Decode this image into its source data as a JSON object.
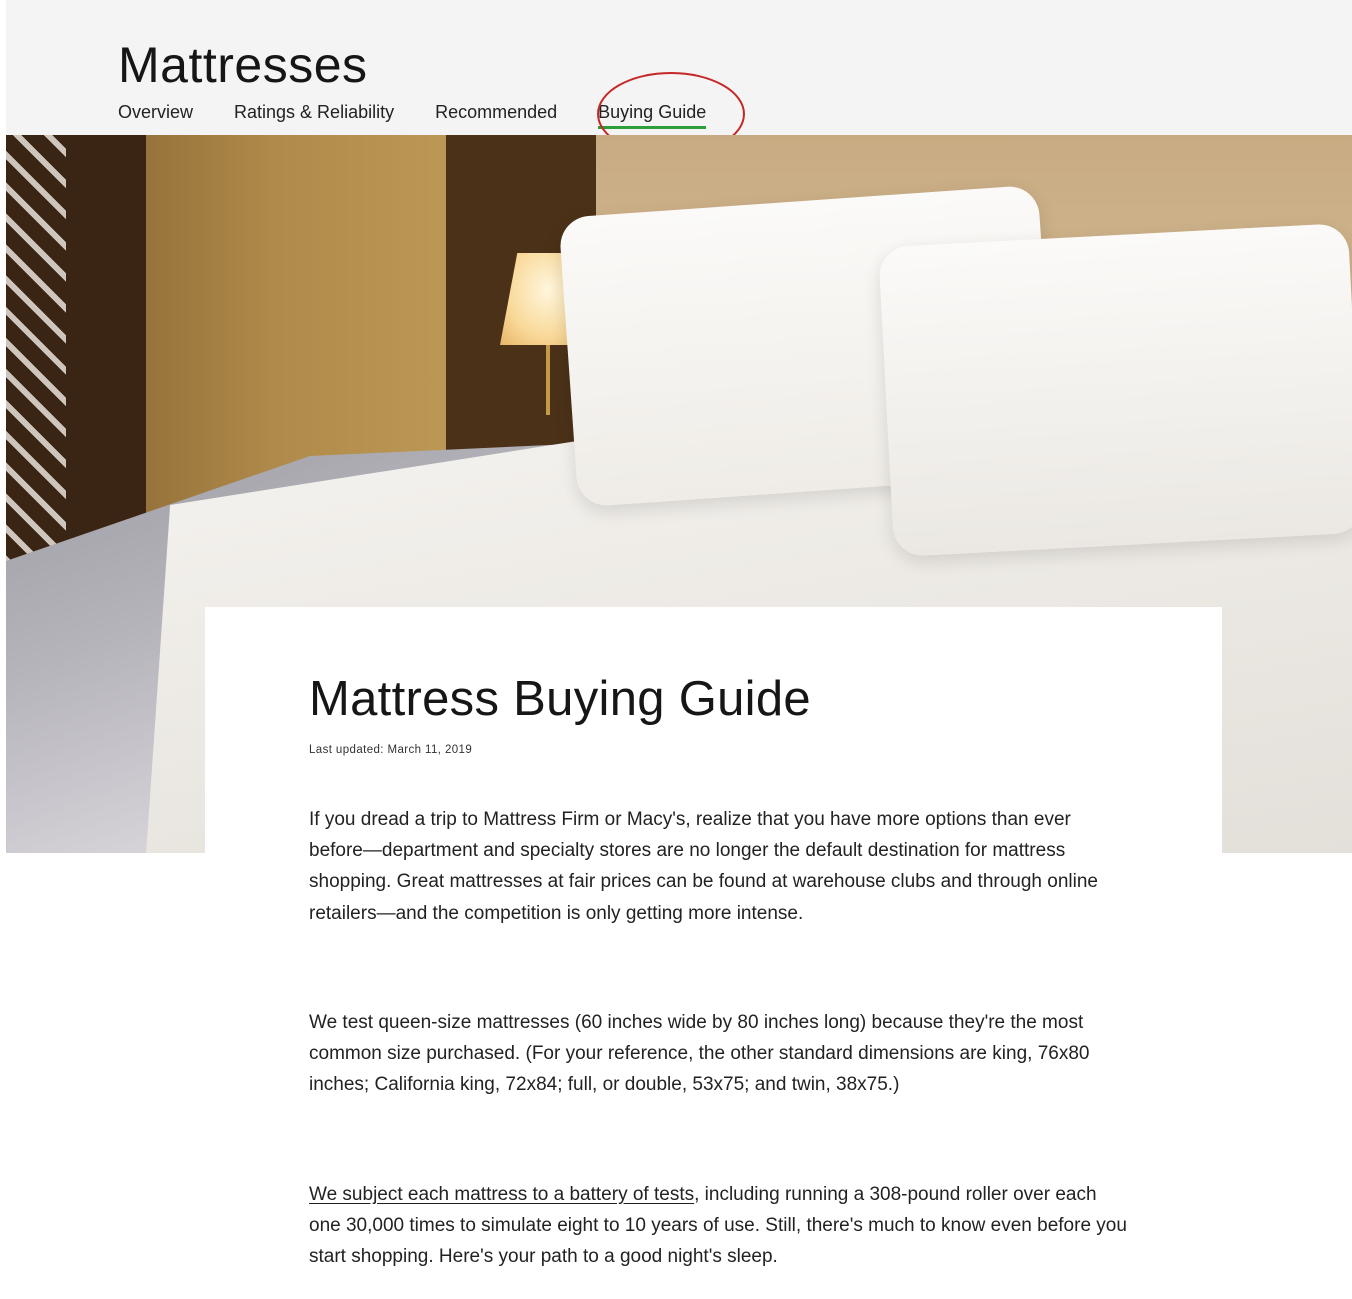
{
  "header": {
    "title": "Mattresses",
    "tabs": [
      {
        "label": "Overview",
        "active": false
      },
      {
        "label": "Ratings & Reliability",
        "active": false
      },
      {
        "label": "Recommended",
        "active": false
      },
      {
        "label": "Buying Guide",
        "active": true
      }
    ],
    "active_tab_color": "#2e9e3a",
    "highlight_color": "#c62828"
  },
  "article": {
    "title": "Mattress Buying Guide",
    "last_updated": "Last updated: March 11, 2019",
    "paragraph_1": "If you dread a trip to Mattress Firm or Macy's, realize that you have more options than ever before—department and specialty stores are no longer the default destination for mattress shopping. Great mattresses at fair prices can be found at warehouse clubs and through online retailers—and the competition is only getting more intense.",
    "paragraph_2": "We test queen-size mattresses (60 inches wide by 80 inches long) because they're the most common size purchased. (For your reference, the other standard dimensions are king, 76x80 inches; California king, 72x84; full, or double, 53x75; and twin, 38x75.)",
    "paragraph_3_link": "We subject each mattress to a battery of tests",
    "paragraph_3_rest": ", including running a 308-pound roller over each one 30,000 times to simulate eight to 10 years of use. Still, there's much to know even before you start shopping. Here's your path to a good night's sleep."
  }
}
